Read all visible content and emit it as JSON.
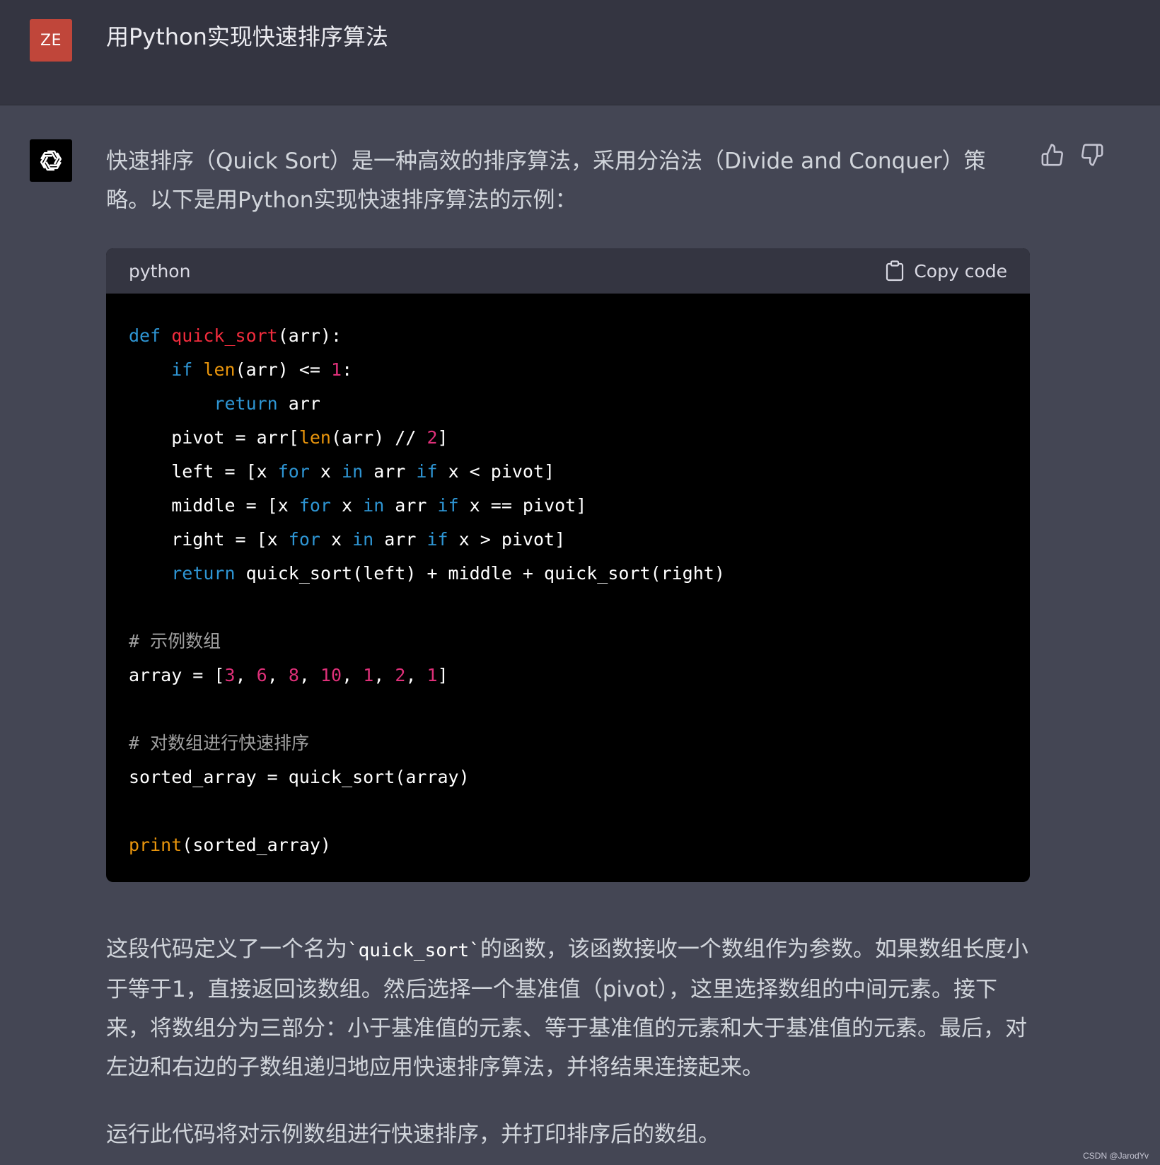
{
  "user": {
    "avatar_text": "ZE",
    "avatar_color": "#c0463a",
    "message": "用Python实现快速排序算法"
  },
  "assistant": {
    "avatar_icon": "openai-logo-icon",
    "intro": "快速排序（Quick Sort）是一种高效的排序算法，采用分治法（Divide and Conquer）策略。以下是用Python实现快速排序算法的示例：",
    "feedback": {
      "like_icon": "thumbs-up-icon",
      "dislike_icon": "thumbs-down-icon"
    },
    "code_block": {
      "language": "python",
      "copy_label": "Copy code",
      "copy_icon": "clipboard-icon",
      "lines": [
        [
          {
            "t": "def",
            "c": "kw"
          },
          {
            "t": " ",
            "c": "pl"
          },
          {
            "t": "quick_sort",
            "c": "fn"
          },
          {
            "t": "(arr):",
            "c": "pl"
          }
        ],
        [
          {
            "t": "    ",
            "c": "pl"
          },
          {
            "t": "if",
            "c": "kw"
          },
          {
            "t": " ",
            "c": "pl"
          },
          {
            "t": "len",
            "c": "bi"
          },
          {
            "t": "(arr) <= ",
            "c": "pl"
          },
          {
            "t": "1",
            "c": "num"
          },
          {
            "t": ":",
            "c": "pl"
          }
        ],
        [
          {
            "t": "        ",
            "c": "pl"
          },
          {
            "t": "return",
            "c": "kw"
          },
          {
            "t": " arr",
            "c": "pl"
          }
        ],
        [
          {
            "t": "    pivot = arr[",
            "c": "pl"
          },
          {
            "t": "len",
            "c": "bi"
          },
          {
            "t": "(arr) // ",
            "c": "pl"
          },
          {
            "t": "2",
            "c": "num"
          },
          {
            "t": "]",
            "c": "pl"
          }
        ],
        [
          {
            "t": "    left = [x ",
            "c": "pl"
          },
          {
            "t": "for",
            "c": "kw"
          },
          {
            "t": " x ",
            "c": "pl"
          },
          {
            "t": "in",
            "c": "kw"
          },
          {
            "t": " arr ",
            "c": "pl"
          },
          {
            "t": "if",
            "c": "kw"
          },
          {
            "t": " x < pivot]",
            "c": "pl"
          }
        ],
        [
          {
            "t": "    middle = [x ",
            "c": "pl"
          },
          {
            "t": "for",
            "c": "kw"
          },
          {
            "t": " x ",
            "c": "pl"
          },
          {
            "t": "in",
            "c": "kw"
          },
          {
            "t": " arr ",
            "c": "pl"
          },
          {
            "t": "if",
            "c": "kw"
          },
          {
            "t": " x == pivot]",
            "c": "pl"
          }
        ],
        [
          {
            "t": "    right = [x ",
            "c": "pl"
          },
          {
            "t": "for",
            "c": "kw"
          },
          {
            "t": " x ",
            "c": "pl"
          },
          {
            "t": "in",
            "c": "kw"
          },
          {
            "t": " arr ",
            "c": "pl"
          },
          {
            "t": "if",
            "c": "kw"
          },
          {
            "t": " x > pivot]",
            "c": "pl"
          }
        ],
        [
          {
            "t": "    ",
            "c": "pl"
          },
          {
            "t": "return",
            "c": "kw"
          },
          {
            "t": " quick_sort(left) + middle + quick_sort(right)",
            "c": "pl"
          }
        ],
        [],
        [
          {
            "t": "# 示例数组",
            "c": "cm"
          }
        ],
        [
          {
            "t": "array = [",
            "c": "pl"
          },
          {
            "t": "3",
            "c": "num"
          },
          {
            "t": ", ",
            "c": "pl"
          },
          {
            "t": "6",
            "c": "num"
          },
          {
            "t": ", ",
            "c": "pl"
          },
          {
            "t": "8",
            "c": "num"
          },
          {
            "t": ", ",
            "c": "pl"
          },
          {
            "t": "10",
            "c": "num"
          },
          {
            "t": ", ",
            "c": "pl"
          },
          {
            "t": "1",
            "c": "num"
          },
          {
            "t": ", ",
            "c": "pl"
          },
          {
            "t": "2",
            "c": "num"
          },
          {
            "t": ", ",
            "c": "pl"
          },
          {
            "t": "1",
            "c": "num"
          },
          {
            "t": "]",
            "c": "pl"
          }
        ],
        [],
        [
          {
            "t": "# 对数组进行快速排序",
            "c": "cm"
          }
        ],
        [
          {
            "t": "sorted_array = quick_sort(array)",
            "c": "pl"
          }
        ],
        [],
        [
          {
            "t": "print",
            "c": "bi"
          },
          {
            "t": "(sorted_array)",
            "c": "pl"
          }
        ]
      ]
    },
    "explanation": {
      "before_code": "这段代码定义了一个名为",
      "inline_code": "`quick_sort`",
      "after_code": "的函数，该函数接收一个数组作为参数。如果数组长度小于等于1，直接返回该数组。然后选择一个基准值（pivot），这里选择数组的中间元素。接下来，将数组分为三部分：小于基准值的元素、等于基准值的元素和大于基准值的元素。最后，对左边和右边的子数组递归地应用快速排序算法，并将结果连接起来。"
    },
    "closing": "运行此代码将对示例数组进行快速排序，并打印排序后的数组。"
  },
  "watermark": "CSDN @JarodYv"
}
